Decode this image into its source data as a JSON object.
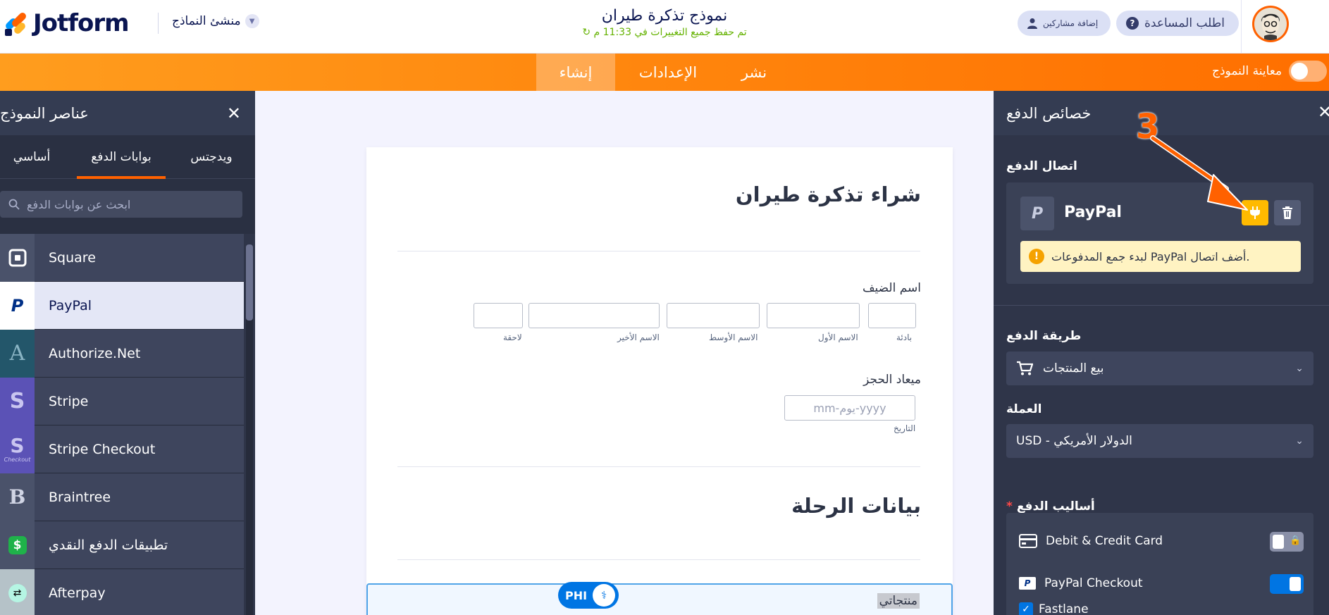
{
  "header": {
    "logo_text": "Jotform",
    "builder_menu": "منشئ النماذج",
    "form_title": "نموذج تذكرة طيران",
    "save_status": "تم حفظ جميع التغييرات في 11:33 م",
    "help_button": "اطلب المساعدة",
    "collab_button": "إضافة مشاركين"
  },
  "nav": {
    "tabs": [
      {
        "label": "إنشاء"
      },
      {
        "label": "الإعدادات"
      },
      {
        "label": "نشر"
      }
    ],
    "preview_label": "معاينة النموذج"
  },
  "left_panel": {
    "title": "عناصر النموذج",
    "tabs": [
      {
        "label": "ويدجتس"
      },
      {
        "label": "بوابات الدفع"
      },
      {
        "label": "أساسي"
      }
    ],
    "search_placeholder": "ابحث عن بوابات الدفع",
    "items": [
      {
        "name": "Square",
        "icon": "square-icon",
        "color": "#4a526a"
      },
      {
        "name": "PayPal",
        "icon": "paypal-icon",
        "color": "#ffffff"
      },
      {
        "name": "Authorize.Net",
        "icon": "authorize-net-icon",
        "color": "#23566a"
      },
      {
        "name": "Stripe",
        "icon": "stripe-icon",
        "color": "#5b52b6"
      },
      {
        "name": "Stripe Checkout",
        "icon": "stripe-checkout-icon",
        "color": "#5b52b6"
      },
      {
        "name": "Braintree",
        "icon": "braintree-icon",
        "color": "#4a526a"
      },
      {
        "name": "تطبيقات الدفع النقدي",
        "icon": "cash-app-icon",
        "color": "#4a526a"
      },
      {
        "name": "Afterpay",
        "icon": "afterpay-icon",
        "color": "#b5f5e3"
      }
    ]
  },
  "form": {
    "heading": "شراء تذكرة طيران",
    "guest_label": "اسم الضيف",
    "name_sublabels": {
      "prefix": "بادئة",
      "first": "الاسم الأول",
      "middle": "الاسم الأوسط",
      "last": "الاسم الأخير",
      "suffix": "لاحقة"
    },
    "date_label": "ميعاد الحجز",
    "date_placeholder": "mm-يوم-yyyy",
    "date_sublabel": "التاريخ",
    "section_heading": "بيانات الرحلة",
    "products_label": "منتجاتي",
    "phi_badge": "PHI"
  },
  "right_panel": {
    "title": "خصائص الدفع",
    "connection_title": "اتصال الدفع",
    "gateway_name": "PayPal",
    "gateway_logo_letter": "P",
    "warning": "لبدء جمع المدفوعات PayPal أضف اتصال.",
    "payment_type_title": "طريقة الدفع",
    "payment_type_value": "بيع المنتجات",
    "currency_title": "العملة",
    "currency_value": "USD - الدولار الأمريكي",
    "methods_title": "أساليب الدفع",
    "methods": [
      {
        "label": "Debit & Credit Card",
        "enabled": true
      },
      {
        "label": "PayPal Checkout",
        "enabled": true
      },
      {
        "label": "Fastlane",
        "checked": true
      }
    ]
  },
  "annotation": {
    "step": "3"
  },
  "colors": {
    "accent": "#ff6100",
    "navy": "#0a1551",
    "panel": "#2f3549",
    "connect_button": "#ffba00",
    "toggle_on": "#0075e3"
  }
}
